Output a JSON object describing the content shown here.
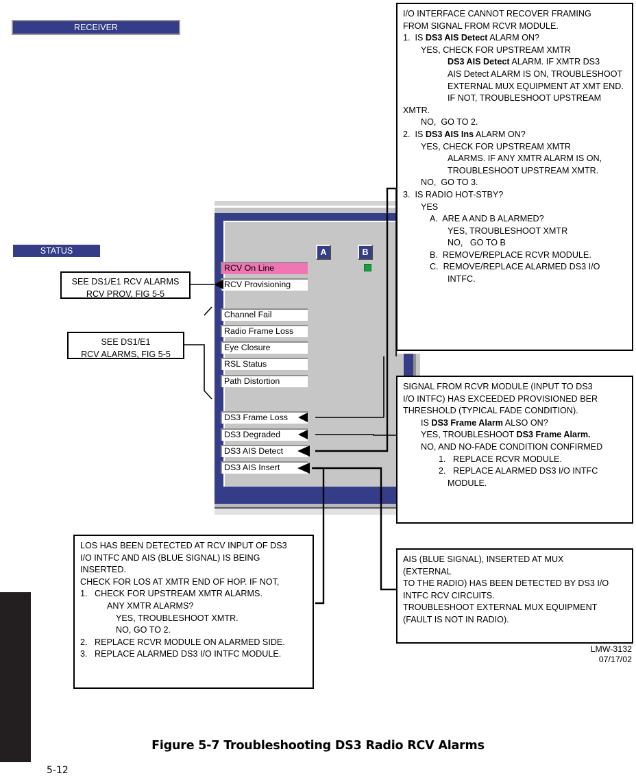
{
  "figure": {
    "caption": "Figure 5-7  Troubleshooting DS3 Radio RCV Alarms",
    "page_number": "5-12",
    "doc_id": "LMW-3132",
    "doc_date": "07/17/02"
  },
  "receiver_panel": {
    "title": "RECEIVER",
    "status_header": "STATUS",
    "column_a_label": "A",
    "column_b_label": "B",
    "led_b_color": "#12a13e",
    "highlight_color": "#f075b5",
    "header_color": "#353c88",
    "fields": [
      {
        "label": "RCV On Line",
        "state": "alarm"
      },
      {
        "label": "RCV Provisioning",
        "state": "normal"
      },
      {
        "label": "Channel Fail",
        "state": "normal"
      },
      {
        "label": "Radio Frame Loss",
        "state": "normal"
      },
      {
        "label": "Eye Closure",
        "state": "normal"
      },
      {
        "label": "RSL Status",
        "state": "normal"
      },
      {
        "label": "Path Distortion",
        "state": "normal"
      },
      {
        "label": "DS3 Frame Loss",
        "state": "normal"
      },
      {
        "label": "DS3 Degraded",
        "state": "normal"
      },
      {
        "label": "DS3 AIS Detect",
        "state": "normal"
      },
      {
        "label": "DS3 AIS Insert",
        "state": "normal"
      }
    ]
  },
  "callouts": {
    "rcv_prov": {
      "lines": [
        "SEE DS1/E1 RCV ALARMS",
        "RCV PROV, FIG 5-5"
      ]
    },
    "rcv_alarms": {
      "lines": [
        "SEE DS1/E1",
        "RCV ALARMS, FIG 5-5"
      ]
    },
    "ais_detect": {
      "lines": [
        {
          "indent": 0,
          "segments": [
            {
              "t": "I/O INTERFACE CANNOT RECOVER FRAMING"
            }
          ]
        },
        {
          "indent": 0,
          "segments": [
            {
              "t": "FROM SIGNAL FROM RCVR MODULE."
            }
          ]
        },
        {
          "indent": 0,
          "segments": [
            {
              "t": "1.  IS "
            },
            {
              "t": "DS3 AIS Detect",
              "b": true
            },
            {
              "t": " ALARM ON?"
            }
          ]
        },
        {
          "indent": 2,
          "segments": [
            {
              "t": "YES, CHECK FOR UPSTREAM XMTR"
            }
          ]
        },
        {
          "indent": 5,
          "segments": [
            {
              "t": "DS3 AIS Detect",
              "b": true
            },
            {
              "t": " ALARM. IF XMTR DS3"
            }
          ]
        },
        {
          "indent": 5,
          "segments": [
            {
              "t": "AIS Detect ALARM IS ON, TROUBLESHOOT"
            }
          ]
        },
        {
          "indent": 5,
          "segments": [
            {
              "t": "EXTERNAL MUX EQUIPMENT AT XMT END."
            }
          ]
        },
        {
          "indent": 5,
          "segments": [
            {
              "t": "IF NOT, TROUBLESHOOT UPSTREAM"
            }
          ]
        },
        {
          "indent": 0,
          "segments": [
            {
              "t": "XMTR."
            }
          ]
        },
        {
          "indent": 2,
          "segments": [
            {
              "t": "NO,  GO TO 2."
            }
          ]
        },
        {
          "indent": 0,
          "segments": [
            {
              "t": "2.  IS "
            },
            {
              "t": "DS3 AIS Ins",
              "b": true
            },
            {
              "t": " ALARM ON?"
            }
          ]
        },
        {
          "indent": 2,
          "segments": [
            {
              "t": "YES, CHECK FOR UPSTREAM XMTR"
            }
          ]
        },
        {
          "indent": 5,
          "segments": [
            {
              "t": "ALARMS. IF ANY XMTR ALARM IS ON,"
            }
          ]
        },
        {
          "indent": 5,
          "segments": [
            {
              "t": "TROUBLESHOOT UPSTREAM XMTR."
            }
          ]
        },
        {
          "indent": 2,
          "segments": [
            {
              "t": "NO,  GO TO 3."
            }
          ]
        },
        {
          "indent": 0,
          "segments": [
            {
              "t": "3.  IS RADIO HOT-STBY?"
            }
          ]
        },
        {
          "indent": 2,
          "segments": [
            {
              "t": "YES"
            }
          ]
        },
        {
          "indent": 3,
          "segments": [
            {
              "t": "A.  ARE A AND B ALARMED?"
            }
          ]
        },
        {
          "indent": 5,
          "segments": [
            {
              "t": "YES, TROUBLESHOOT XMTR"
            }
          ]
        },
        {
          "indent": 5,
          "segments": [
            {
              "t": "NO,   GO TO B"
            }
          ]
        },
        {
          "indent": 3,
          "segments": [
            {
              "t": "B.  REMOVE/REPLACE RCVR MODULE."
            }
          ]
        },
        {
          "indent": 3,
          "segments": [
            {
              "t": "C.  REMOVE/REPLACE ALARMED DS3 I/O"
            }
          ]
        },
        {
          "indent": 5,
          "segments": [
            {
              "t": "INTFC."
            }
          ]
        }
      ]
    },
    "ds3_degraded": {
      "lines": [
        {
          "indent": 0,
          "segments": [
            {
              "t": "SIGNAL FROM RCVR MODULE (INPUT TO DS3"
            }
          ]
        },
        {
          "indent": 0,
          "segments": [
            {
              "t": "I/O INTFC) HAS EXCEEDED PROVISIONED BER"
            }
          ]
        },
        {
          "indent": 0,
          "segments": [
            {
              "t": "THRESHOLD (TYPICAL FADE CONDITION)."
            }
          ]
        },
        {
          "indent": 2,
          "segments": [
            {
              "t": "IS "
            },
            {
              "t": "DS3 Frame Alarm",
              "b": true
            },
            {
              "t": " ALSO ON?"
            }
          ]
        },
        {
          "indent": 2,
          "segments": [
            {
              "t": "YES, TROUBLESHOOT "
            },
            {
              "t": "DS3 Frame Alarm.",
              "b": true
            }
          ]
        },
        {
          "indent": 2,
          "segments": [
            {
              "t": "NO, AND NO-FADE CONDITION CONFIRMED"
            }
          ]
        },
        {
          "indent": 4,
          "segments": [
            {
              "t": "1.   REPLACE RCVR MODULE."
            }
          ]
        },
        {
          "indent": 4,
          "segments": [
            {
              "t": "2.   REPLACE ALARMED DS3 I/O INTFC"
            }
          ]
        },
        {
          "indent": 5,
          "segments": [
            {
              "t": "MODULE."
            }
          ]
        }
      ]
    },
    "ais_insert": {
      "lines": [
        {
          "indent": 0,
          "segments": [
            {
              "t": "AIS (BLUE SIGNAL), INSERTED AT MUX"
            }
          ]
        },
        {
          "indent": 0,
          "segments": [
            {
              "t": "(EXTERNAL"
            }
          ]
        },
        {
          "indent": 0,
          "segments": [
            {
              "t": "TO THE RADIO) HAS BEEN DETECTED BY DS3 I/O"
            }
          ]
        },
        {
          "indent": 0,
          "segments": [
            {
              "t": "INTFC RCV CIRCUITS."
            }
          ]
        },
        {
          "indent": 0,
          "segments": [
            {
              "t": "TROUBLESHOOT EXTERNAL MUX EQUIPMENT"
            }
          ]
        },
        {
          "indent": 0,
          "segments": [
            {
              "t": "(FAULT IS NOT IN RADIO)."
            }
          ]
        }
      ]
    },
    "ds3_frame_loss": {
      "lines": [
        {
          "indent": 0,
          "segments": [
            {
              "t": "LOS HAS BEEN DETECTED AT RCV INPUT OF DS3"
            }
          ]
        },
        {
          "indent": 0,
          "segments": [
            {
              "t": "I/O INTFC AND AIS (BLUE SIGNAL) IS BEING"
            }
          ]
        },
        {
          "indent": 0,
          "segments": [
            {
              "t": "INSERTED."
            }
          ]
        },
        {
          "indent": 0,
          "segments": [
            {
              "t": "CHECK FOR LOS AT XMTR END OF HOP. IF NOT,"
            }
          ]
        },
        {
          "indent": 0,
          "segments": [
            {
              "t": "1.   CHECK FOR UPSTREAM XMTR ALARMS."
            }
          ]
        },
        {
          "indent": 3,
          "segments": [
            {
              "t": "ANY XMTR ALARMS?"
            }
          ]
        },
        {
          "indent": 4,
          "segments": [
            {
              "t": "YES, TROUBLESHOOT XMTR."
            }
          ]
        },
        {
          "indent": 4,
          "segments": [
            {
              "t": "NO, GO TO 2."
            }
          ]
        },
        {
          "indent": 0,
          "segments": [
            {
              "t": "2.   REPLACE RCVR MODULE ON ALARMED SIDE."
            }
          ]
        },
        {
          "indent": 0,
          "segments": [
            {
              "t": "3.   REPLACE ALARMED DS3 I/O INTFC MODULE."
            }
          ]
        }
      ]
    }
  }
}
